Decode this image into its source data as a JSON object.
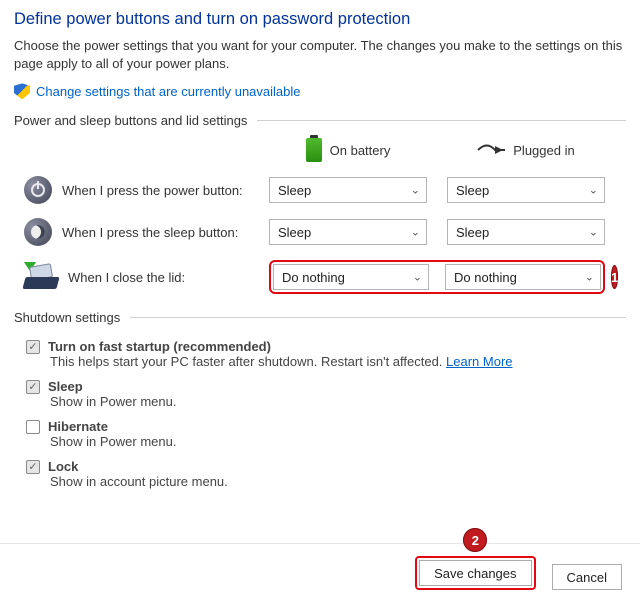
{
  "title": "Define power buttons and turn on password protection",
  "subtitle": "Choose the power settings that you want for your computer. The changes you make to the settings on this page apply to all of your power plans.",
  "change_link": "Change settings that are currently unavailable",
  "section_power": {
    "header": "Power and sleep buttons and lid settings",
    "columns": {
      "battery": "On battery",
      "plugged": "Plugged in"
    },
    "rows": {
      "power_btn": {
        "label": "When I press the power button:",
        "battery": "Sleep",
        "plugged": "Sleep"
      },
      "sleep_btn": {
        "label": "When I press the sleep button:",
        "battery": "Sleep",
        "plugged": "Sleep"
      },
      "lid": {
        "label": "When I close the lid:",
        "battery": "Do nothing",
        "plugged": "Do nothing"
      }
    }
  },
  "section_shutdown": {
    "header": "Shutdown settings",
    "fast_startup": {
      "title": "Turn on fast startup (recommended)",
      "desc": "This helps start your PC faster after shutdown. Restart isn't affected. ",
      "learn_more": "Learn More",
      "checked": true
    },
    "sleep": {
      "title": "Sleep",
      "desc": "Show in Power menu.",
      "checked": true
    },
    "hibernate": {
      "title": "Hibernate",
      "desc": "Show in Power menu.",
      "checked": false
    },
    "lock": {
      "title": "Lock",
      "desc": "Show in account picture menu.",
      "checked": true
    }
  },
  "callouts": {
    "lid": "1",
    "save": "2"
  },
  "buttons": {
    "save": "Save changes",
    "cancel": "Cancel"
  }
}
